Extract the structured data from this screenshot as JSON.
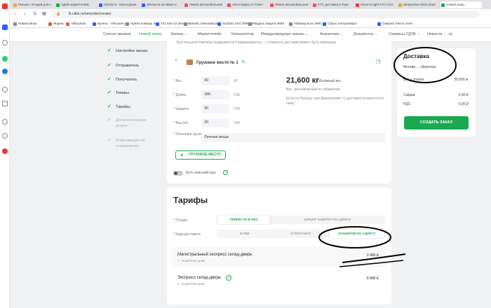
{
  "browser": {
    "tabs": [
      {
        "label": "Письмо «Я идей для с",
        "color": "#f5a623"
      },
      {
        "label": "СДЭК маркетплейс",
        "color": "#1aa94f"
      },
      {
        "label": "OZON.ru - Мои корзин",
        "color": "#2962ff"
      },
      {
        "label": "Запчасти на sklad.ru",
        "color": "#2962ff"
      },
      {
        "label": "Лампа автомобильная",
        "color": "#ef5350"
      },
      {
        "label": "Автотовары от Санкт",
        "color": "#ef5350"
      },
      {
        "label": "Лампа автомобильная",
        "color": "#ef5350"
      },
      {
        "label": "KTC доставка в Томс",
        "color": "#ef5350"
      },
      {
        "label": "Oscar Knight КТС KSO",
        "color": "#e53935"
      },
      {
        "label": "Шпаргалка 2022-2023",
        "color": "#f5a623"
      },
      {
        "label": "Новый заказ",
        "color": "#1aa94f"
      }
    ],
    "url": "lk.cdek.ru/neworder/creator",
    "bookmarks": [
      {
        "label": "Новая папка",
        "color": "#888888"
      },
      {
        "label": "Яндекс",
        "color": "#ef5350"
      },
      {
        "label": "AliExpress",
        "color": "#ef5350"
      },
      {
        "label": "Кронос - VW-parts.r",
        "color": "#2962ff"
      },
      {
        "label": "Нужна помощь по т",
        "color": "#888888"
      },
      {
        "label": "T31 или X2 (Nissan",
        "color": "#2962ff"
      },
      {
        "label": "Brands | ManualsLib",
        "color": "#888888"
      },
      {
        "label": "SUZUKI SX4 2006 13",
        "color": "#2962ff"
      },
      {
        "label": "Модуль защиты BMS",
        "color": "#888888"
      },
      {
        "label": "Таблица всех SMD к",
        "color": "#888888"
      },
      {
        "label": "Сброс контроллера",
        "color": "#2962ff"
      },
      {
        "label": "Озвучка текста онла",
        "color": "#2962ff"
      }
    ]
  },
  "site_nav": {
    "items": [
      "Список заказов",
      "Новый заказ",
      "Заказы",
      "Маркетплейс",
      "Калькулятор",
      "Международные заказы",
      "Аналитика",
      "Документы",
      "Сервисы СДЭК",
      "Новости"
    ],
    "news_badge": "99"
  },
  "steps": [
    {
      "label": "Настройка заказа"
    },
    {
      "label": "Отправитель"
    },
    {
      "label": "Получатель"
    },
    {
      "label": "Товары"
    },
    {
      "label": "Тарифы"
    },
    {
      "label": "Дополнительные услуги"
    },
    {
      "label": "Информация об отправлении"
    }
  ],
  "package": {
    "note": "Все посылки повторно измеряются и взвешиваются — стоимость доставки может быть изменена",
    "title": "Грузовое место № 1",
    "fields": [
      {
        "label": "Вес",
        "value": "30",
        "unit": "КГ"
      },
      {
        "label": "Длина",
        "value": "180",
        "unit": "СМ"
      },
      {
        "label": "Ширина",
        "value": "30",
        "unit": "СМ"
      },
      {
        "label": "Высота",
        "value": "20",
        "unit": "СМ"
      }
    ],
    "volume_weight": "21,600 кг",
    "volume_weight_label": "Объёмный вес",
    "volume_caption": "Вес, рассчитанный по габаритам",
    "volume_hint": "Если он больше чем физический, то доставка оплатится по нему",
    "description_label": "Описание груза",
    "description_value": "Личные вещи",
    "add_button": "ГРУЗОВОЕ МЕСТО",
    "dangerous_label": "Есть опасный груз"
  },
  "tariffs": {
    "title": "Тарифы",
    "from_label": "Откуда",
    "from_options": [
      "ПРИНЕСТИ В ПВЗ",
      "КУРЬЕР ЗАБЕРЁТ ПО АДРЕСУ"
    ],
    "to_label": "Куда доставить",
    "to_options": [
      "В ПВЗ",
      "В ПОСТАМАТ",
      "КУРЬЕРОМ ПО АДРЕСУ"
    ],
    "rows": [
      {
        "name": "Магистральный экспресс склад-дверь",
        "days": "7 - 8 рабочих дней",
        "price": "2 490 ₽"
      },
      {
        "name": "Экспресс склад-дверь",
        "days": "4 - 5 рабочих дней",
        "price": "8 890 ₽"
      }
    ]
  },
  "delivery": {
    "title": "Доставка",
    "route": "Москва → Шерегеш",
    "cod_label": "Вес к оплате",
    "cod_value": "30,000 кг",
    "discount_label": "Скидка",
    "discount_value": "0,00 ₽",
    "vat_label": "НДС",
    "vat_value": "0,00 ₽",
    "create_button": "СОЗДАТЬ ЗАКАЗ"
  },
  "colors": {
    "brand_green": "#1aa94f",
    "annotation": "#000000"
  }
}
